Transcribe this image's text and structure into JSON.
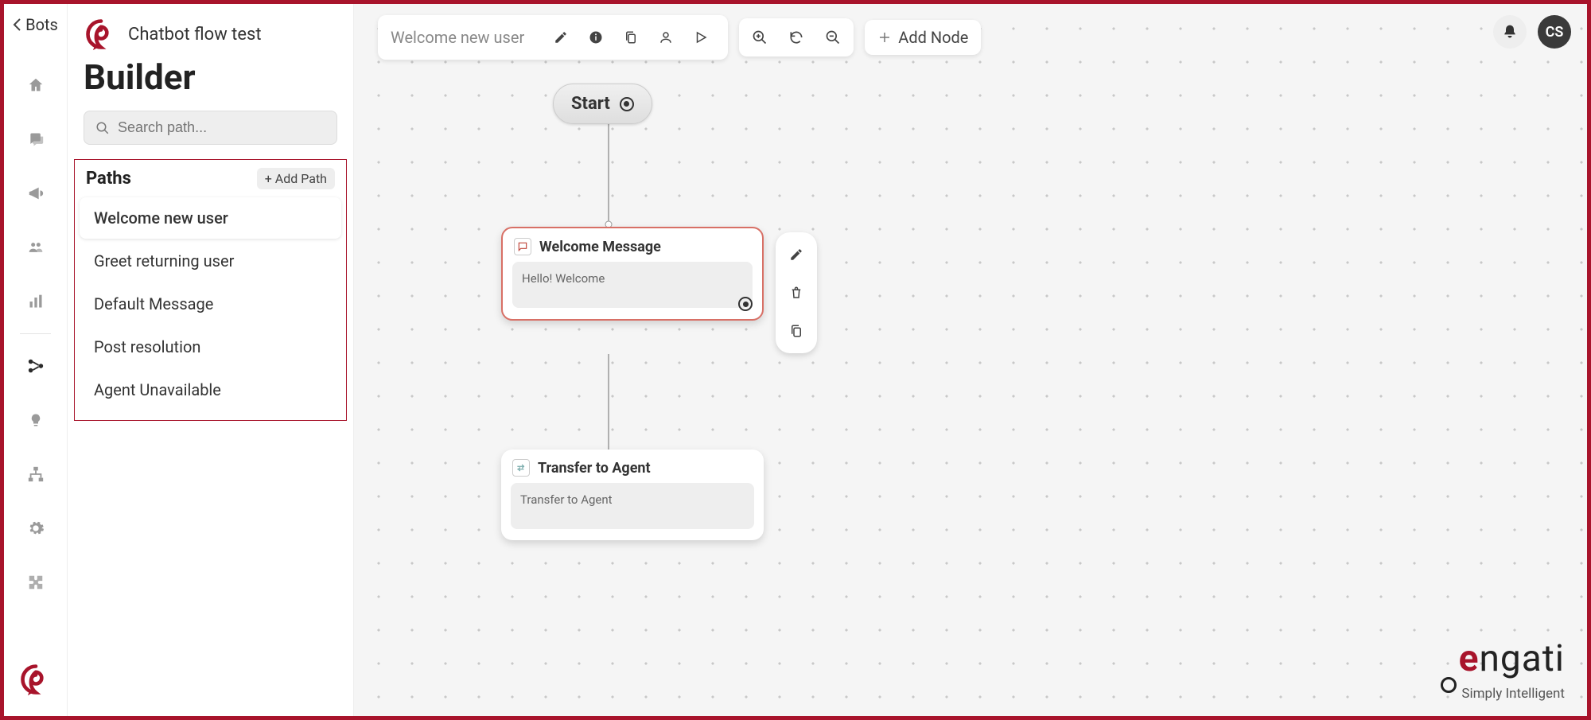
{
  "back": {
    "label": "Bots"
  },
  "header": {
    "flow_name": "Chatbot flow test",
    "builder_title": "Builder"
  },
  "search": {
    "placeholder": "Search path..."
  },
  "paths": {
    "title": "Paths",
    "add_label": "+ Add Path",
    "items": [
      {
        "label": "Welcome new user",
        "selected": true
      },
      {
        "label": "Greet returning user",
        "selected": false
      },
      {
        "label": "Default Message",
        "selected": false
      },
      {
        "label": "Post resolution",
        "selected": false
      },
      {
        "label": "Agent Unavailable",
        "selected": false
      }
    ]
  },
  "toolbar": {
    "path_title": "Welcome new user",
    "add_node": "Add Node"
  },
  "user": {
    "initials": "CS"
  },
  "nodes": {
    "start": {
      "label": "Start"
    },
    "welcome": {
      "title": "Welcome Message",
      "body": "Hello! Welcome"
    },
    "transfer": {
      "title": "Transfer to Agent",
      "body": "Transfer to Agent"
    }
  },
  "brand": {
    "name_pre": "e",
    "name_rest": "ngati",
    "tagline": "Simply Intelligent"
  }
}
